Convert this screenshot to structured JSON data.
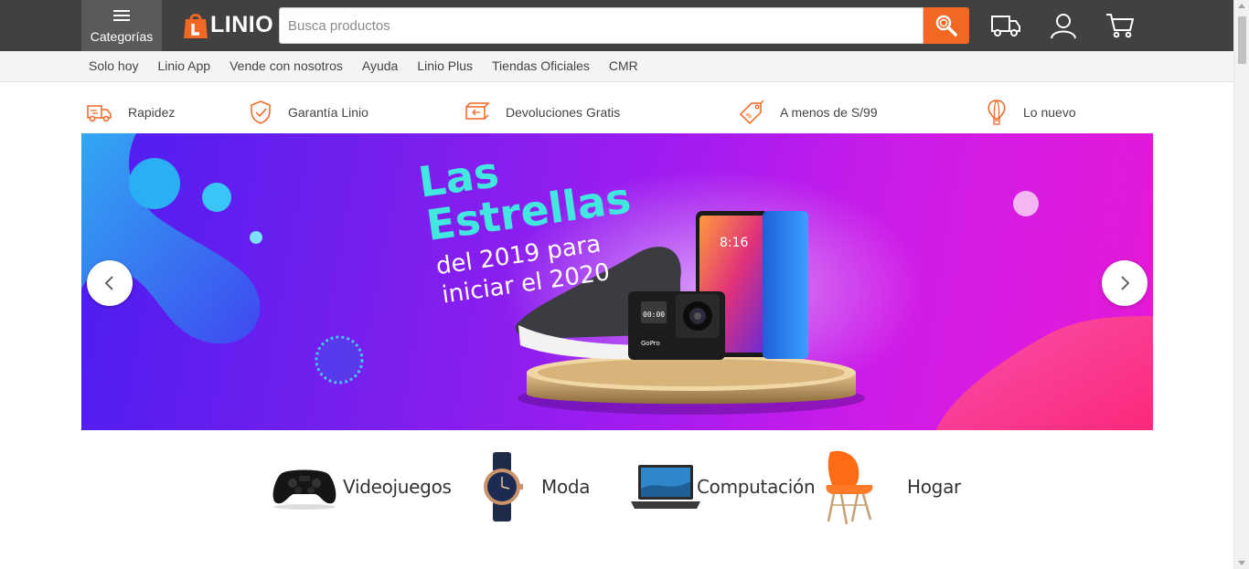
{
  "header": {
    "categories_label": "Categorías",
    "logo_text": "LINIO",
    "search_placeholder": "Busca productos",
    "icons": [
      "search-icon",
      "truck-icon",
      "user-icon",
      "cart-icon"
    ]
  },
  "nav": {
    "items": [
      {
        "label": "Solo hoy"
      },
      {
        "label": "Linio App"
      },
      {
        "label": "Vende con nosotros"
      },
      {
        "label": "Ayuda"
      },
      {
        "label": "Linio Plus"
      },
      {
        "label": "Tiendas Oficiales"
      },
      {
        "label": "CMR"
      }
    ]
  },
  "benefits": [
    {
      "label": "Rapidez",
      "icon": "fast-delivery-icon"
    },
    {
      "label": "Garantía Linio",
      "icon": "shield-check-icon"
    },
    {
      "label": "Devoluciones Gratis",
      "icon": "return-box-icon"
    },
    {
      "label": "A menos de S/99",
      "icon": "price-tag-icon"
    },
    {
      "label": "Lo nuevo",
      "icon": "hot-air-balloon-icon"
    }
  ],
  "banner": {
    "line1": "Las",
    "line2": "Estrellas",
    "line3": "del 2019 para",
    "line4": "iniciar el 2020",
    "phone_time": "8:16",
    "camera_brand": "GoPro",
    "camera_display": "00:00"
  },
  "categories": [
    {
      "label": "Videojuegos",
      "icon": "gamepad-icon"
    },
    {
      "label": "Moda",
      "icon": "watch-icon"
    },
    {
      "label": "Computación",
      "icon": "laptop-icon"
    },
    {
      "label": "Hogar",
      "icon": "chair-icon"
    }
  ],
  "colors": {
    "brand_orange": "#f26722",
    "header_bg": "#414141",
    "accent_cyan": "#3de0e6"
  }
}
